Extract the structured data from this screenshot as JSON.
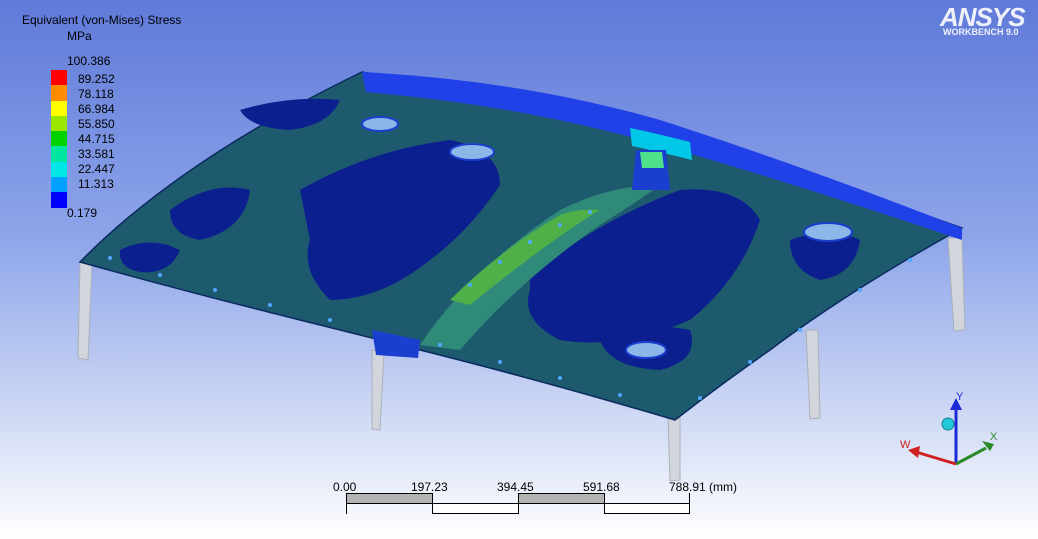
{
  "legend": {
    "title": "Equivalent (von-Mises) Stress",
    "unit": "MPa",
    "max": "100.386",
    "levels": [
      "89.252",
      "78.118",
      "66.984",
      "55.850",
      "44.715",
      "33.581",
      "22.447",
      "11.313"
    ],
    "min": "0.179",
    "colors": [
      "#ff0000",
      "#ff8c00",
      "#ffff00",
      "#9be600",
      "#00d200",
      "#00e6a0",
      "#00e6e6",
      "#00a0ff",
      "#0000ff"
    ]
  },
  "logo": {
    "brand": "ANSYS",
    "product": "WORKBENCH 9.0"
  },
  "scale_bar": {
    "ticks": [
      "0.00",
      "197.23",
      "394.45",
      "591.68",
      "788.91 (mm)"
    ]
  },
  "triad": {
    "x_label": "X",
    "y_label": "Y",
    "w_label": "W"
  },
  "colors": {
    "panel_base": "#1e5a6e",
    "low_stress": "#0b1f8f",
    "edge_band": "#2040e8",
    "support_posts": "#d2d6dc"
  }
}
